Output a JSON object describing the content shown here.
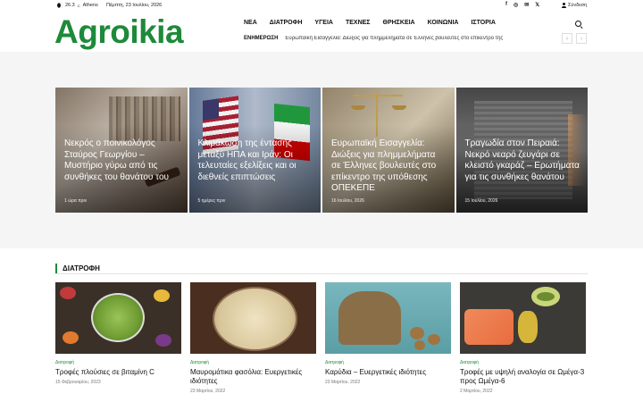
{
  "topbar": {
    "temperature": "26.3",
    "degree": "C",
    "city": "Athens",
    "date": "Πέμπτη, 23 Ιουλίου, 2026",
    "social": [
      "f",
      "◎",
      "✉",
      "𝕏"
    ],
    "login": "Σύνδεση"
  },
  "header": {
    "logo": "Agroikia",
    "nav": [
      "ΝΕΑ",
      "ΔΙΑΤΡΟΦΗ",
      "ΥΓΕΙΑ",
      "ΤΕΧΝΕΣ",
      "ΘΡΗΣΚΕΙΑ",
      "ΚΟΙΝΩΝΙΑ",
      "ΙΣΤΟΡΙΑ"
    ],
    "ticker_label": "ΕΝΗΜΕΡΩΣΗ",
    "ticker_text": "Ευρωπαϊκή Εισαγγελία: Διώξεις για πλημμελήματα σε Έλληνες βουλευτές στο επίκεντρο της",
    "prev": "‹",
    "next": "›"
  },
  "hero": [
    {
      "title": "Νεκρός ο ποινικολόγος Σταύρος Γεωργίου – Μυστήριο γύρω από τις συνθήκες του θανάτου του",
      "date": "1 ώρα πριν"
    },
    {
      "title": "Κλιμάκωση της έντασης μεταξύ ΗΠΑ και Ιράν: Οι τελευταίες εξελίξεις και οι διεθνείς επιπτώσεις",
      "date": "5 ημέρες πριν"
    },
    {
      "title": "Ευρωπαϊκή Εισαγγελία: Διώξεις για πλημμελήματα σε Έλληνες βουλευτές στο επίκεντρο της υπόθεσης ΟΠΕΚΕΠΕ",
      "date": "16 Ιουλίου, 2026"
    },
    {
      "title": "Τραγωδία στον Πειραιά: Νεκρό νεαρό ζευγάρι σε κλειστό γκαράζ – Ερωτήματα για τις συνθήκες θανάτου",
      "date": "15 Ιουλίου, 2026"
    }
  ],
  "section": {
    "heading": "ΔΙΑΤΡΟΦΗ",
    "posts": [
      {
        "category": "Διατροφή",
        "title": "Τροφές πλούσιες σε βιταμίνη C",
        "date": "15 Φεβρουαρίου, 2023"
      },
      {
        "category": "Διατροφή",
        "title": "Μαυρομάτικα φασόλια: Ευεργετικές ιδιότητες",
        "date": "23 Μαρτίου, 2022"
      },
      {
        "category": "Διατροφή",
        "title": "Καρύδια – Ευεργετικές ιδιότητες",
        "date": "23 Μαρτίου, 2022"
      },
      {
        "category": "Διατροφή",
        "title": "Τροφές με υψηλή αναλογία σε Ωμέγα-3 προς Ωμέγα-6",
        "date": "2 Μαρτίου, 2022"
      }
    ]
  },
  "colors": {
    "brand": "#1d8a3a"
  }
}
